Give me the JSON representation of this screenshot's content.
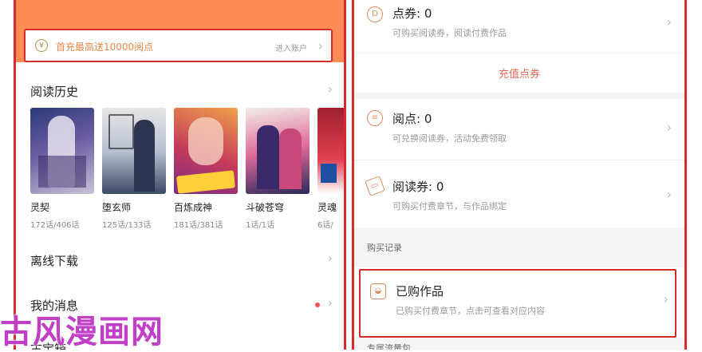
{
  "left": {
    "promo": {
      "icon": "yen-coin-icon",
      "text": "首充最高送10000阅点",
      "link": "进入账户"
    },
    "history": {
      "title": "阅读历史"
    },
    "books": [
      {
        "title": "灵契",
        "progress": "172话/406话",
        "palette": [
          "#2b3b7a",
          "#c8c3d8",
          "#6a5ba1"
        ]
      },
      {
        "title": "堕玄师",
        "progress": "125话/133话",
        "palette": [
          "#d9d9d9",
          "#3d4a66",
          "#9aa7c4"
        ]
      },
      {
        "title": "百炼成神",
        "progress": "181话/381话",
        "palette": [
          "#c43a5a",
          "#f0a04a",
          "#7b2b8a"
        ]
      },
      {
        "title": "斗破苍穹",
        "progress": "1话/1话",
        "palette": [
          "#5a4a8a",
          "#e06a9a",
          "#2a2a5a"
        ]
      },
      {
        "title": "灵魂",
        "progress": "6话/",
        "palette": [
          "#a02030",
          "#e04050",
          "#ffffff"
        ]
      }
    ],
    "offline": {
      "title": "离线下载"
    },
    "messages": {
      "title": "我的消息"
    },
    "bottom_partial": {
      "title": "古宝箱"
    },
    "watermark": "古风漫画网"
  },
  "right": {
    "coupon": {
      "icon": "coupon-coin-icon",
      "title": "点券: 0",
      "sub": "可购买阅读券，阅读付费作品"
    },
    "recharge_link": "充值点券",
    "points": {
      "icon": "points-icon",
      "title": "阅点: 0",
      "sub": "可兑换阅读券，活动免费领取"
    },
    "ticket": {
      "icon": "ticket-icon",
      "title": "阅读券: 0",
      "sub": "可购买付费章节，与作品绑定"
    },
    "purchase_section": "购买记录",
    "purchased": {
      "icon": "bag-icon",
      "title": "已购作品",
      "sub": "已购买付费章节，点击可查看对应内容"
    },
    "bottom_partial": "专属流量包"
  }
}
